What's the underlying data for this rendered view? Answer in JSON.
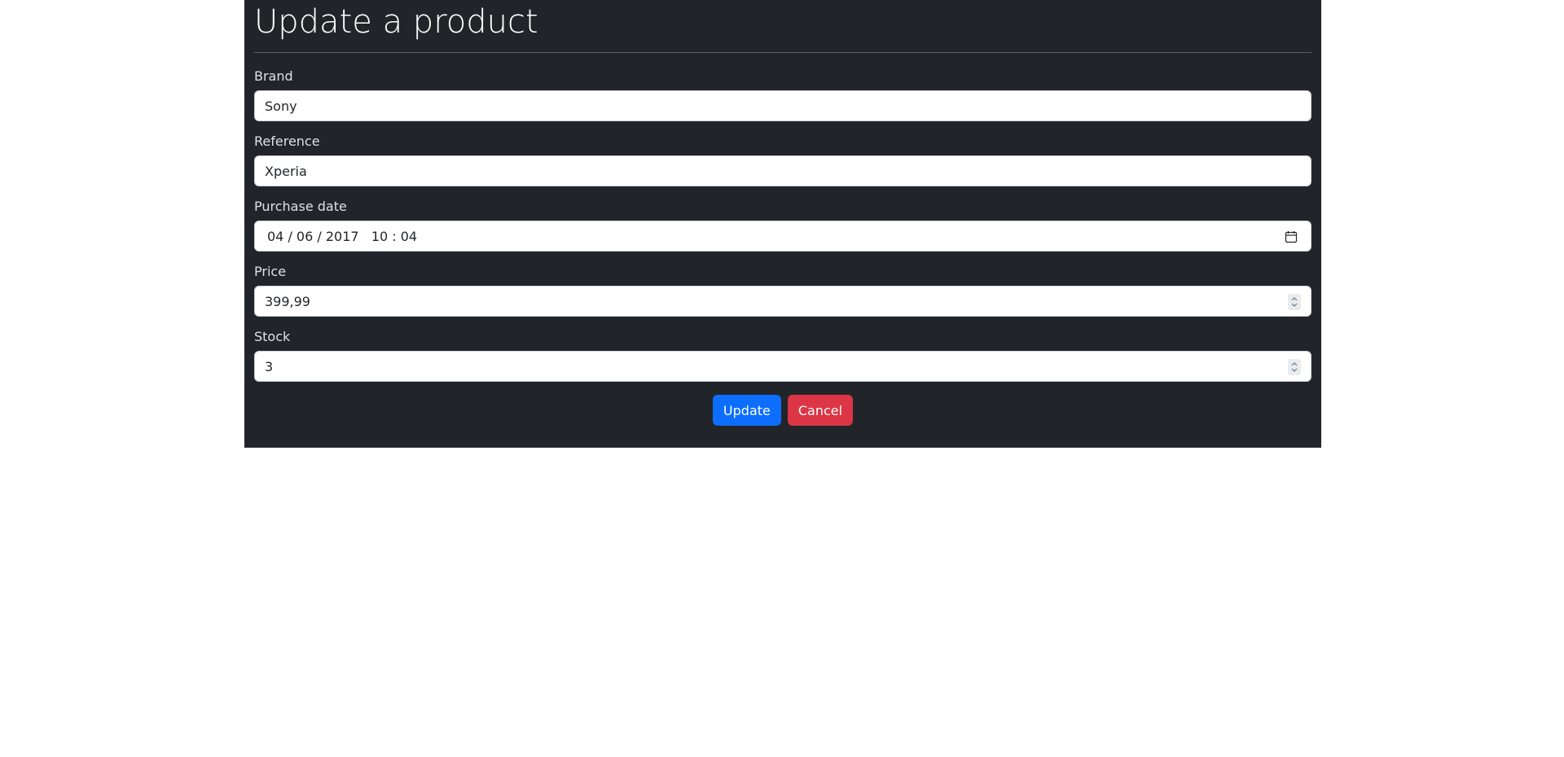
{
  "page": {
    "title": "Update a product"
  },
  "form": {
    "brand": {
      "label": "Brand",
      "value": "Sony"
    },
    "reference": {
      "label": "Reference",
      "value": "Xperia"
    },
    "purchase_date": {
      "label": "Purchase date",
      "value": "04 / 06 / 2017   10 : 04"
    },
    "price": {
      "label": "Price",
      "value": "399,99"
    },
    "stock": {
      "label": "Stock",
      "value": "3"
    }
  },
  "actions": {
    "update_label": "Update",
    "cancel_label": "Cancel"
  },
  "icons": {
    "date_icon": "calendar-icon",
    "number_icon": "spinner-icon"
  },
  "colors": {
    "panel_bg": "#212529",
    "primary": "#0d6efd",
    "danger": "#dc3545"
  }
}
